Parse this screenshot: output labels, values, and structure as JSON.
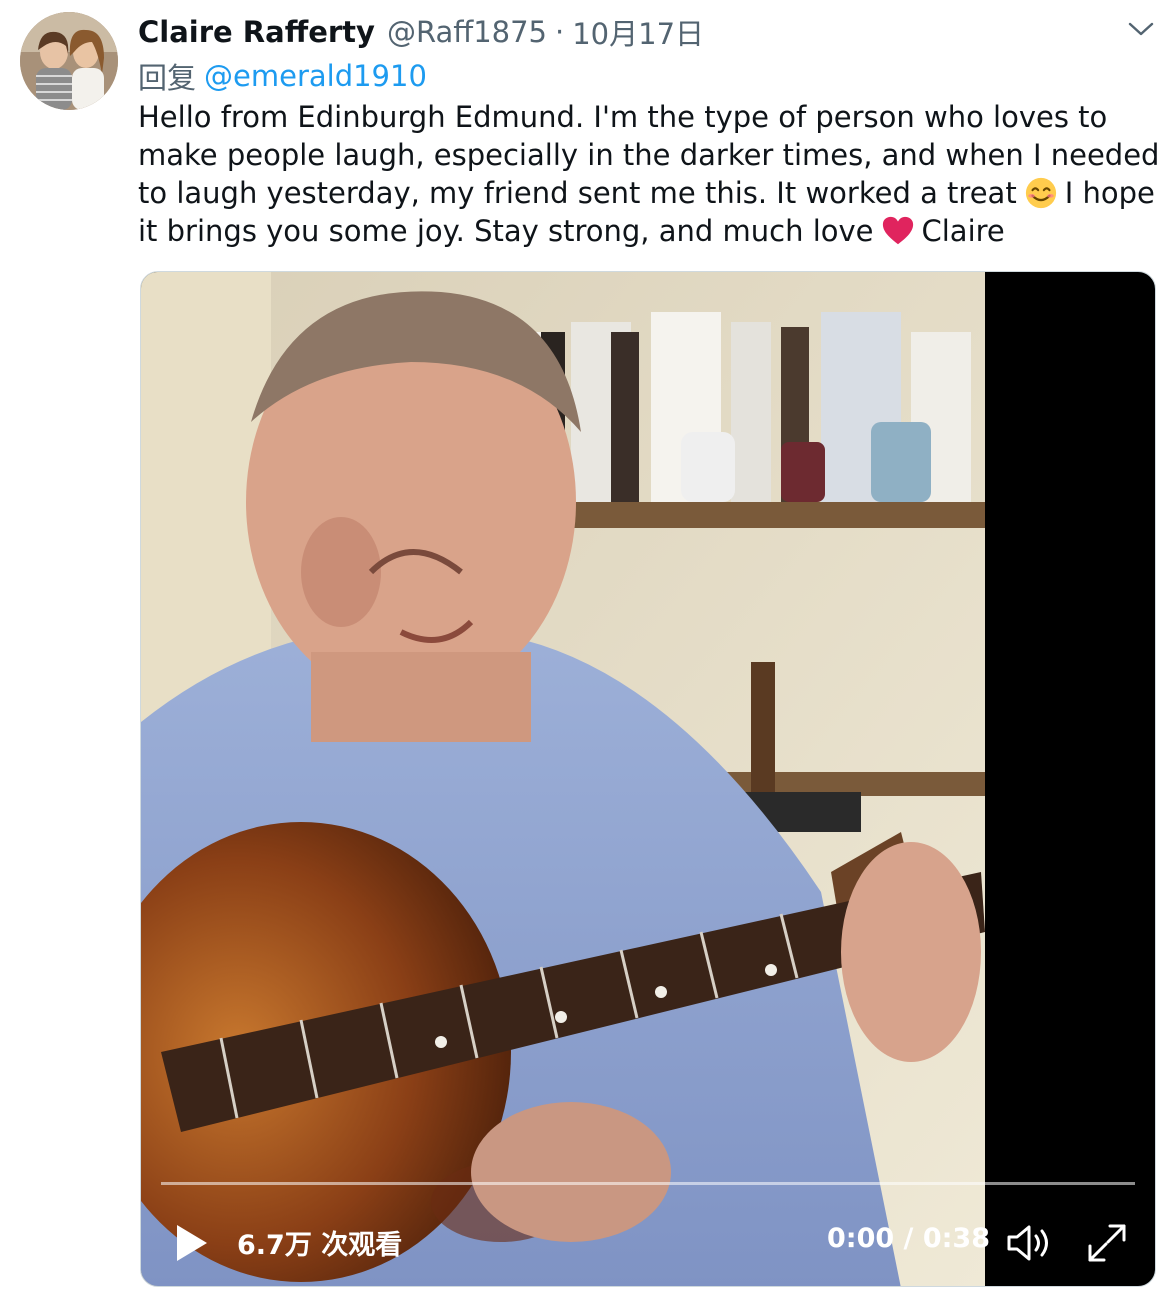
{
  "tweet": {
    "author": {
      "display_name": "Claire Rafferty",
      "handle": "@Raff1875"
    },
    "separator": "·",
    "date": "10月17日",
    "reply": {
      "prefix": "回复",
      "target": "@emerald1910"
    },
    "body_lines": [
      "Hello from Edinburgh Edmund. I'm the type of person who loves to",
      "make people laugh, especially in the darker times, and when I needed",
      "to laugh yesterday, my friend sent me this. It worked a treat",
      "I hope",
      "it brings you some joy. Stay strong, and much love",
      "Claire"
    ],
    "emojis": [
      "smiling-face-emoji",
      "red-heart-emoji"
    ]
  },
  "video": {
    "views": "6.7万 次观看",
    "time_current": "0:00",
    "time_total": "0:38",
    "time_display": "0:00 / 0:38",
    "progress": 0
  },
  "icons": {
    "caret": "chevron-down-icon",
    "play": "play-icon",
    "volume": "volume-icon",
    "fullscreen": "fullscreen-icon"
  },
  "colors": {
    "text_primary": "#0f1419",
    "text_secondary": "#536471",
    "link": "#1d9bf0",
    "heart": "#e0245e",
    "emoji_face": "#ffcc4d"
  }
}
